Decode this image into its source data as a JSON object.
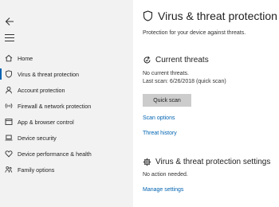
{
  "colors": {
    "accent": "#0063b1",
    "sidebar_bg": "#f2f2f2",
    "button_bg": "#cccccc"
  },
  "sidebar": {
    "back_icon": "back-arrow-icon",
    "menu_icon": "hamburger-icon",
    "items": [
      {
        "label": "Home",
        "icon": "home-icon",
        "active": false
      },
      {
        "label": "Virus & threat protection",
        "icon": "shield-icon",
        "active": true
      },
      {
        "label": "Account protection",
        "icon": "person-icon",
        "active": false
      },
      {
        "label": "Firewall & network protection",
        "icon": "wifi-icon",
        "active": false
      },
      {
        "label": "App & browser control",
        "icon": "app-window-icon",
        "active": false
      },
      {
        "label": "Device security",
        "icon": "laptop-icon",
        "active": false
      },
      {
        "label": "Device performance & health",
        "icon": "heart-icon",
        "active": false
      },
      {
        "label": "Family options",
        "icon": "family-icon",
        "active": false
      }
    ]
  },
  "main": {
    "title": "Virus & threat protection",
    "subtitle": "Protection for your device against threats.",
    "current_threats": {
      "title": "Current threats",
      "status": "No current threats.",
      "last_scan": "Last scan: 6/26/2018 (quick scan)",
      "quick_scan_label": "Quick scan",
      "scan_options_link": "Scan options",
      "threat_history_link": "Threat history"
    },
    "settings": {
      "title": "Virus & threat protection settings",
      "status": "No action needed.",
      "manage_link": "Manage settings"
    }
  }
}
